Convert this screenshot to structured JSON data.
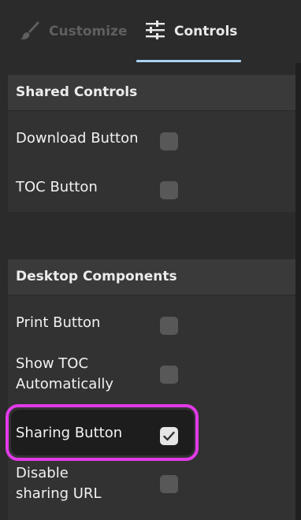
{
  "tabs": {
    "customize": {
      "label": "Customize",
      "icon": "brush-icon"
    },
    "controls": {
      "label": "Controls",
      "icon": "sliders-icon"
    },
    "active": "controls",
    "accent": "#a9d2f1"
  },
  "shared": {
    "title": "Shared Controls",
    "items": [
      {
        "label": "Download Button",
        "checked": false
      },
      {
        "label": "TOC Button",
        "checked": false
      }
    ]
  },
  "desktop": {
    "title": "Desktop Components",
    "items": [
      {
        "label": "Print Button",
        "checked": false
      },
      {
        "label": "Show TOC\nAutomatically",
        "checked": false
      },
      {
        "label": "Sharing Button",
        "checked": true
      },
      {
        "label": "Disable\nsharing URL",
        "checked": false
      }
    ]
  },
  "colors": {
    "highlight": "#e23ae8"
  }
}
